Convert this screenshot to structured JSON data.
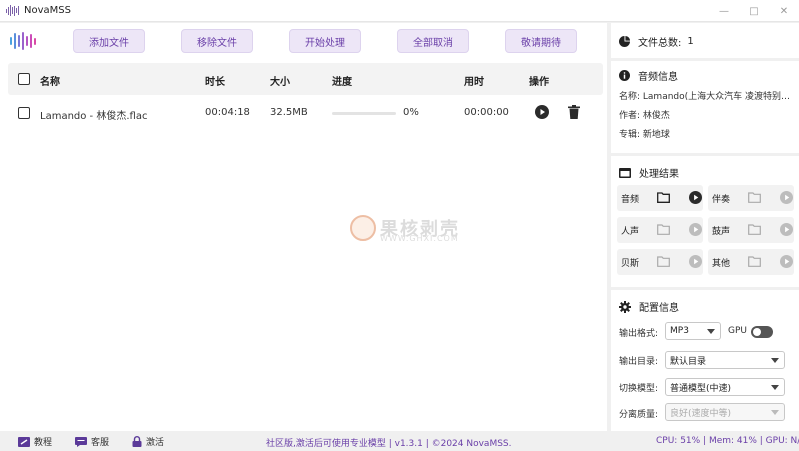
{
  "app": {
    "title": "NovaMSS"
  },
  "toolbar": {
    "add_files": "添加文件",
    "remove_files": "移除文件",
    "start_processing": "开始处理",
    "cancel_all": "全部取消",
    "stay_tuned": "敬请期待"
  },
  "table": {
    "columns": [
      "名称",
      "时长",
      "大小",
      "进度",
      "用时",
      "操作"
    ],
    "rows": [
      {
        "name": "Lamando - 林俊杰.flac",
        "duration": "00:04:18",
        "size": "32.5MB",
        "progress": "0%",
        "elapsed": "00:00:00"
      }
    ]
  },
  "file_count": {
    "label": "文件总数:",
    "value": "1"
  },
  "audio_info": {
    "title": "音频信息",
    "name": "名称:   Lamando(上海大众汽车 凌渡特别…",
    "author": "作者:   林俊杰",
    "album": "专辑:   新地球"
  },
  "results": {
    "title": "处理结果",
    "items": [
      "音频",
      "伴奏",
      "人声",
      "鼓声",
      "贝斯",
      "其他"
    ]
  },
  "config": {
    "title": "配置信息",
    "output_format_label": "输出格式:",
    "output_format_value": "MP3",
    "gpu_label": "GPU",
    "output_dir_label": "输出目录:",
    "output_dir_value": "默认目录",
    "model_label": "切换模型:",
    "model_value": "普通模型(中速)",
    "quality_label": "分离质量:",
    "quality_value": "良好(速度中等)"
  },
  "watermark": {
    "text": "果核剥壳",
    "url": "WWW.GHXI.COM"
  },
  "footer": {
    "tutorial": "教程",
    "support": "客服",
    "activate": "激活",
    "notice": "社区版,激活后可使用专业模型 | v1.3.1 | ©2024 NovaMSS.",
    "stats": "CPU: 51% | Mem: 41% | GPU: N/"
  },
  "colors": {
    "accent": "#6a3fa8",
    "button_bg": "#ede6f7"
  }
}
